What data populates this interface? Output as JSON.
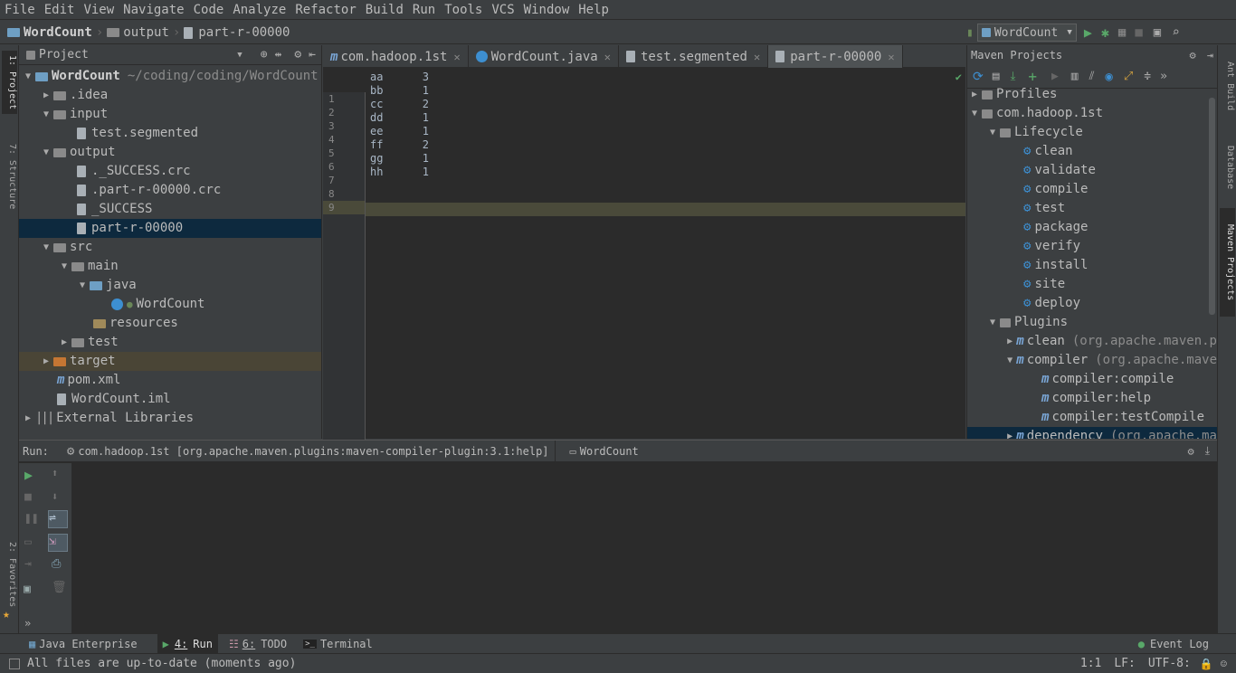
{
  "menu": [
    "File",
    "Edit",
    "View",
    "Navigate",
    "Code",
    "Analyze",
    "Refactor",
    "Build",
    "Run",
    "Tools",
    "VCS",
    "Window",
    "Help"
  ],
  "breadcrumb": {
    "project": "WordCount",
    "folder": "output",
    "file": "part-r-00000"
  },
  "run_config": "WordCount",
  "project_panel": {
    "title": "Project",
    "root_name": "WordCount",
    "root_path": "~/coding/coding/WordCount",
    "items": [
      {
        "label": ".idea"
      },
      {
        "label": "input"
      },
      {
        "label": "test.segmented"
      },
      {
        "label": "output"
      },
      {
        "label": "._SUCCESS.crc"
      },
      {
        "label": ".part-r-00000.crc"
      },
      {
        "label": "_SUCCESS"
      },
      {
        "label": "part-r-00000"
      },
      {
        "label": "src"
      },
      {
        "label": "main"
      },
      {
        "label": "java"
      },
      {
        "label": "WordCount"
      },
      {
        "label": "resources"
      },
      {
        "label": "test"
      },
      {
        "label": "target"
      },
      {
        "label": "pom.xml"
      },
      {
        "label": "WordCount.iml"
      },
      {
        "label": "External Libraries"
      }
    ]
  },
  "editor": {
    "tabs": [
      "com.hadoop.1st",
      "WordCount.java",
      "test.segmented",
      "part-r-00000"
    ],
    "line_numbers": [
      "1",
      "2",
      "3",
      "4",
      "5",
      "6",
      "7",
      "8",
      "9"
    ],
    "lines": [
      "aa\t3",
      "bb\t1",
      "cc\t2",
      "dd\t1",
      "ee\t1",
      "ff\t2",
      "gg\t1",
      "hh\t1",
      ""
    ]
  },
  "maven": {
    "title": "Maven Projects",
    "profiles": "Profiles",
    "project": "com.hadoop.1st",
    "lifecycle": "Lifecycle",
    "phases": [
      "clean",
      "validate",
      "compile",
      "test",
      "package",
      "verify",
      "install",
      "site",
      "deploy"
    ],
    "plugins": "Plugins",
    "plugin_clean": "clean",
    "plugin_clean_detail": "(org.apache.maven.p",
    "plugin_compiler": "compiler",
    "plugin_compiler_detail": "(org.apache.mave",
    "goals": [
      "compiler:compile",
      "compiler:help",
      "compiler:testCompile"
    ],
    "plugin_dependency": "dependency",
    "plugin_dependency_detail": "(org.apache.ma"
  },
  "run_panel": {
    "label": "Run:",
    "tab1": "com.hadoop.1st [org.apache.maven.plugins:maven-compiler-plugin:3.1:help]",
    "tab2": "WordCount"
  },
  "tool_tabs": {
    "javaee": "Java Enterprise",
    "run_num": "4:",
    "run": "Run",
    "todo_num": "6:",
    "todo": "TODO",
    "terminal": "Terminal",
    "eventlog": "Event Log"
  },
  "status": {
    "message": "All files are up-to-date (moments ago)",
    "position": "1:1",
    "line_sep": "LF:",
    "encoding": "UTF-8:"
  },
  "side_tabs": {
    "left_top": "1: Project",
    "left_mid": "7: Structure",
    "left_bottom": "2: Favorites",
    "right_top": "Ant Build",
    "right_mid": "Database",
    "right_bottom": "Maven Projects"
  }
}
